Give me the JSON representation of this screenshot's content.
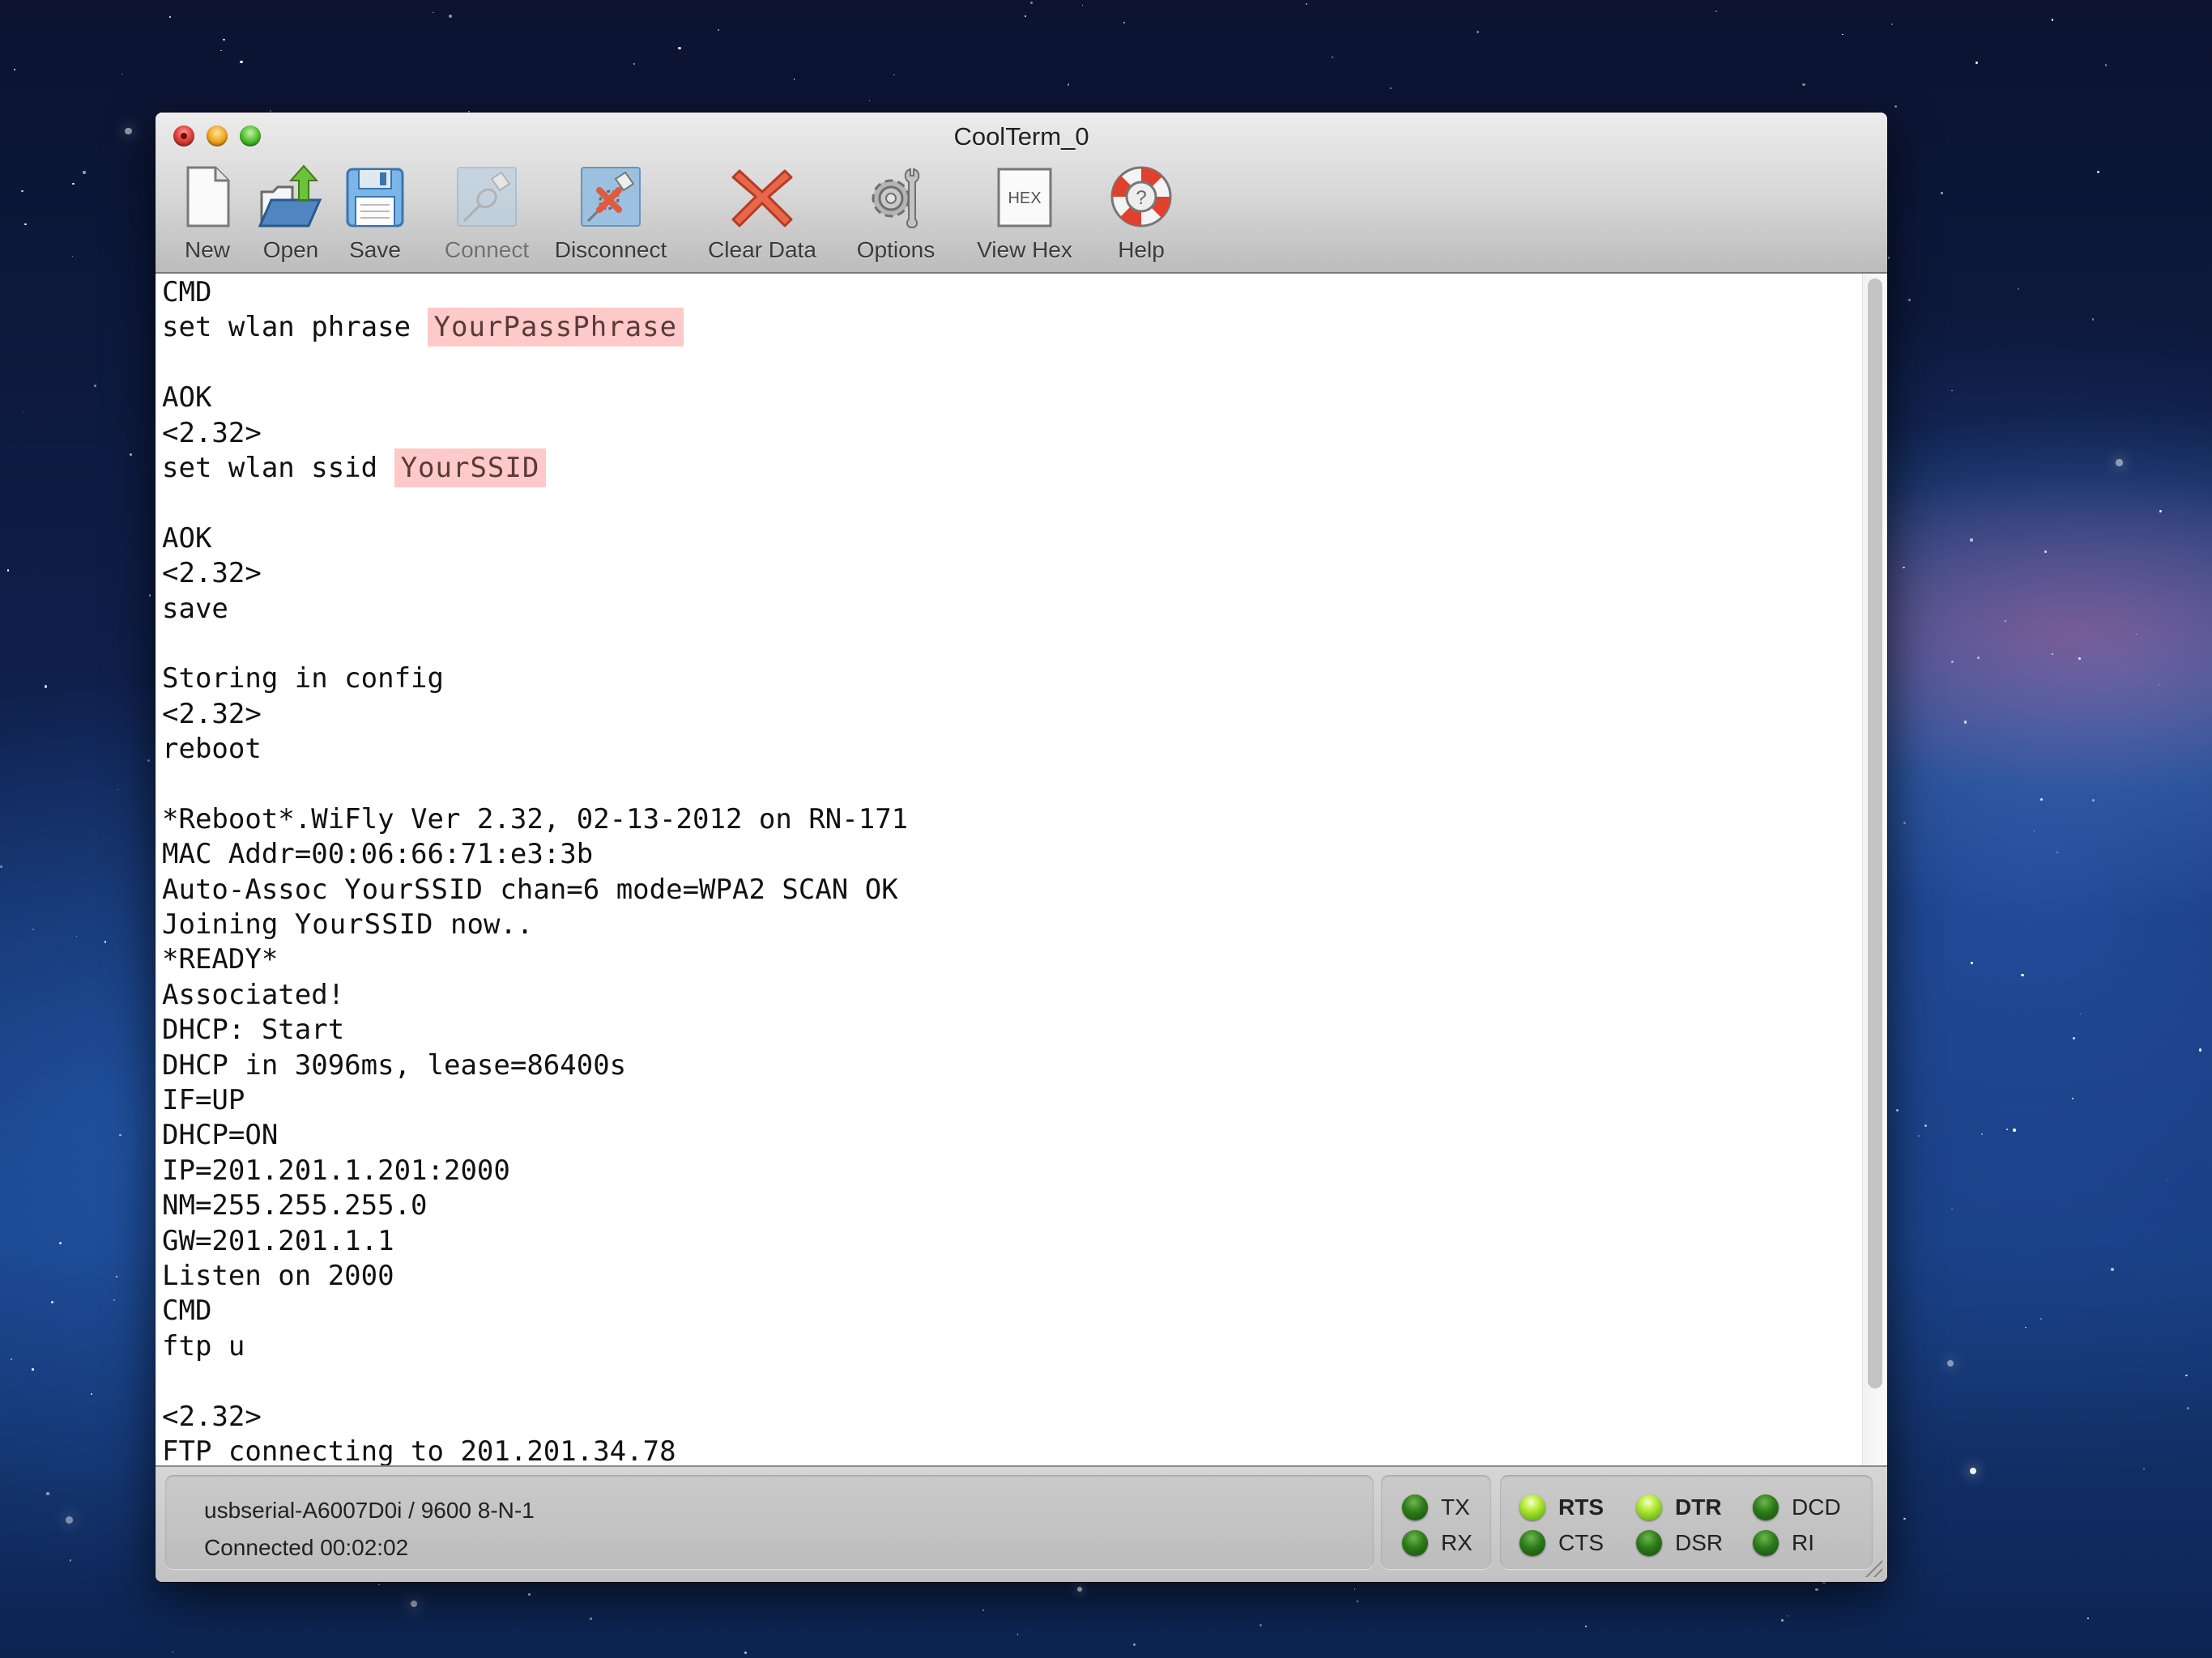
{
  "window": {
    "title": "CoolTerm_0"
  },
  "toolbar": {
    "items": [
      {
        "label": "New",
        "icon": "new-document-icon",
        "enabled": true
      },
      {
        "label": "Open",
        "icon": "open-folder-icon",
        "enabled": true
      },
      {
        "label": "Save",
        "icon": "save-floppy-icon",
        "enabled": true
      },
      {
        "label": "Connect",
        "icon": "connect-plug-icon",
        "enabled": false
      },
      {
        "label": "Disconnect",
        "icon": "disconnect-plug-icon",
        "enabled": true
      },
      {
        "label": "Clear Data",
        "icon": "clear-x-icon",
        "enabled": true
      },
      {
        "label": "Options",
        "icon": "gear-wrench-icon",
        "enabled": true
      },
      {
        "label": "View Hex",
        "icon": "hex-icon",
        "enabled": true
      },
      {
        "label": "Help",
        "icon": "lifebuoy-help-icon",
        "enabled": true
      }
    ],
    "hex_glyph": "HEX"
  },
  "terminal": {
    "highlight_color": "#fec9c9",
    "lines": [
      [
        {
          "t": "CMD"
        }
      ],
      [
        {
          "t": "set wlan phrase "
        },
        {
          "t": "YourPassPhrase",
          "hl": true
        }
      ],
      [],
      [
        {
          "t": "AOK"
        }
      ],
      [
        {
          "t": "<2.32>"
        }
      ],
      [
        {
          "t": "set wlan ssid "
        },
        {
          "t": "YourSSID",
          "hl": true
        }
      ],
      [],
      [
        {
          "t": "AOK"
        }
      ],
      [
        {
          "t": "<2.32>"
        }
      ],
      [
        {
          "t": "save"
        }
      ],
      [],
      [
        {
          "t": "Storing in config"
        }
      ],
      [
        {
          "t": "<2.32>"
        }
      ],
      [
        {
          "t": "reboot"
        }
      ],
      [],
      [
        {
          "t": "*Reboot*.WiFly Ver 2.32, 02-13-2012 on RN-171"
        }
      ],
      [
        {
          "t": "MAC Addr=00:06:66:71:e3:3b"
        }
      ],
      [
        {
          "t": "Auto-Assoc "
        },
        {
          "t": "YourSSID",
          "var": true
        },
        {
          "t": " chan=6 mode=WPA2 SCAN OK"
        }
      ],
      [
        {
          "t": "Joining "
        },
        {
          "t": "YourSSID",
          "var": true
        },
        {
          "t": " now.."
        }
      ],
      [
        {
          "t": "*READY*"
        }
      ],
      [
        {
          "t": "Associated!"
        }
      ],
      [
        {
          "t": "DHCP: Start"
        }
      ],
      [
        {
          "t": "DHCP in 3096ms, lease=86400s"
        }
      ],
      [
        {
          "t": "IF=UP"
        }
      ],
      [
        {
          "t": "DHCP=ON"
        }
      ],
      [
        {
          "t": "IP=201.201.1.201:2000"
        }
      ],
      [
        {
          "t": "NM=255.255.255.0"
        }
      ],
      [
        {
          "t": "GW=201.201.1.1"
        }
      ],
      [
        {
          "t": "Listen on 2000"
        }
      ],
      [
        {
          "t": "CMD"
        }
      ],
      [
        {
          "t": "ftp u"
        }
      ],
      [],
      [
        {
          "t": "<2.32>"
        }
      ],
      [
        {
          "t": "FTP connecting to 201.201.34.78"
        }
      ]
    ]
  },
  "statusbar": {
    "port_info": "usbserial-A6007D0i / 9600 8-N-1",
    "connection_status": "Connected 00:02:02",
    "leds": [
      {
        "label": "TX",
        "on": false
      },
      {
        "label": "RX",
        "on": false
      },
      {
        "label": "RTS",
        "on": true
      },
      {
        "label": "CTS",
        "on": false
      },
      {
        "label": "DTR",
        "on": true
      },
      {
        "label": "DSR",
        "on": false
      },
      {
        "label": "DCD",
        "on": false
      },
      {
        "label": "RI",
        "on": false
      }
    ]
  }
}
